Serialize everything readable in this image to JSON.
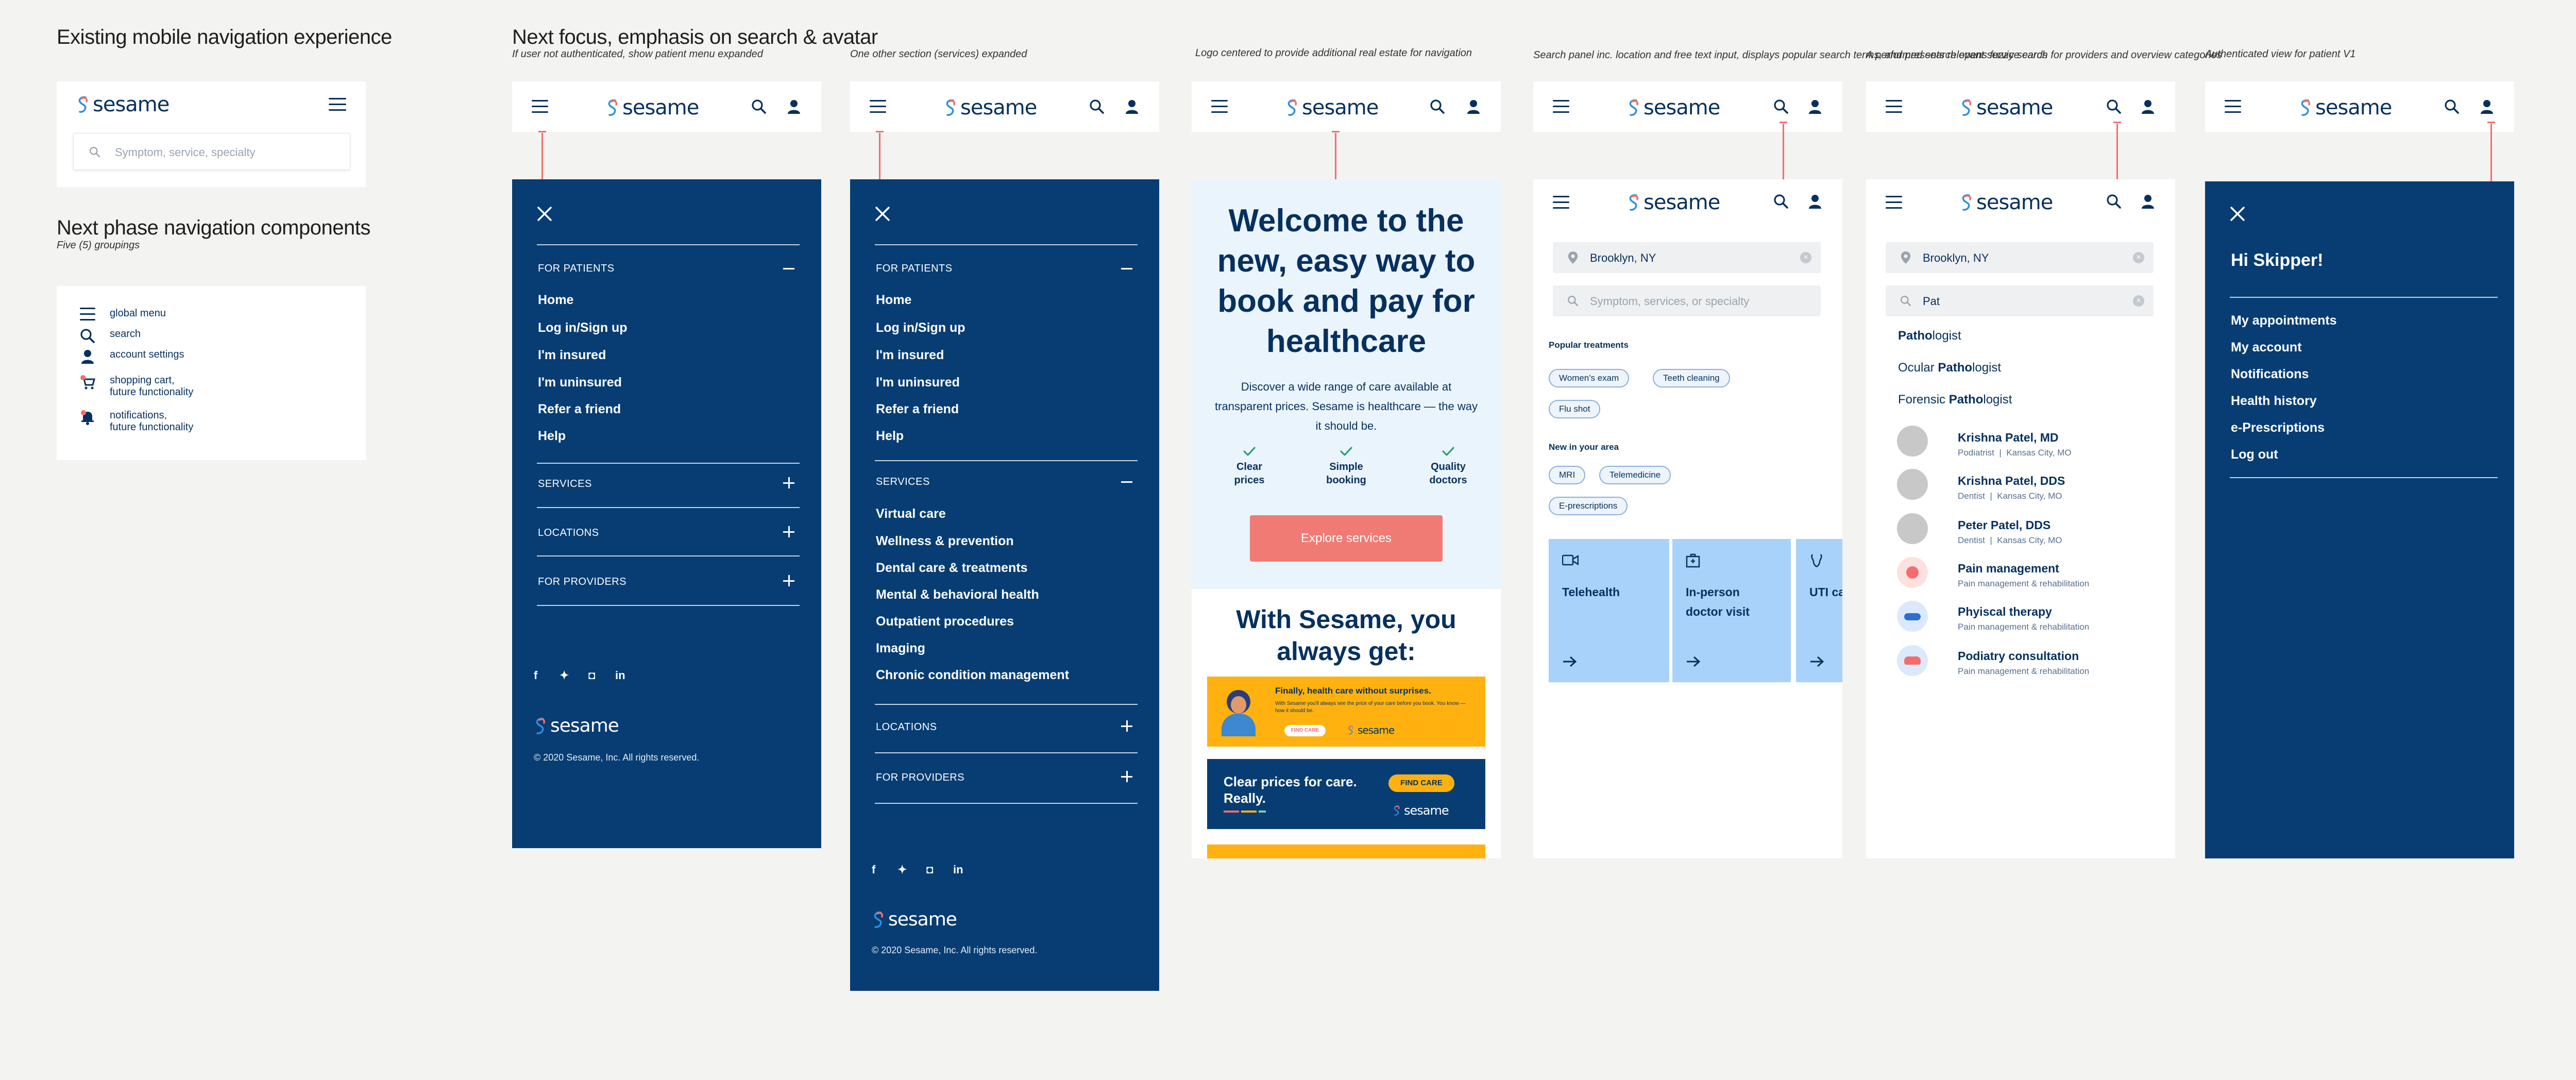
{
  "headings": {
    "existing": "Existing mobile navigation experience",
    "next_focus": "Next focus, emphasis on search & avatar",
    "next_focus_sub": "If user not authenticated, show patient menu expanded",
    "next_phase": "Next phase navigation components",
    "next_phase_sub": "Five (5) groupings"
  },
  "captions": {
    "c3": "One other section (services) expanded",
    "c4": "Logo centered to provide additional real estate for navigation",
    "c5": "Search panel inc. location and free text input, displays popular search terms, and presents relevant service cards",
    "c6": "A performed search opens fuzzy search for providers and overview categories",
    "c7": "Authenticated view for patient V1"
  },
  "brand": {
    "logo_text": "sesame",
    "navy": "#073d73",
    "accent": "#f46d6d"
  },
  "existing": {
    "search_placeholder": "Symptom, service, specialty"
  },
  "legend": [
    {
      "icon": "hamburger-icon",
      "label": "global menu"
    },
    {
      "icon": "search-icon",
      "label": "search"
    },
    {
      "icon": "user-icon",
      "label": "account settings"
    },
    {
      "icon": "cart-icon",
      "label": "shopping cart,",
      "label2": "future functionality"
    },
    {
      "icon": "bell-icon",
      "label": "notifications,",
      "label2": "future functionality"
    }
  ],
  "menu": {
    "for_patients": "FOR PATIENTS",
    "patients_items": [
      "Home",
      "Log in/Sign up",
      "I'm insured",
      "I'm uninsured",
      "Refer a friend",
      "Help"
    ],
    "services": "SERVICES",
    "services_items": [
      "Virtual care",
      "Wellness & prevention",
      "Dental care & treatments",
      "Mental & behavioral health",
      "Outpatient procedures",
      "Imaging",
      "Chronic condition management"
    ],
    "locations": "LOCATIONS",
    "for_providers": "FOR PROVIDERS",
    "copyright": "© 2020 Sesame, Inc. All rights reserved."
  },
  "hero": {
    "title": "Welcome to the new, easy way to book and pay for healthcare",
    "body": "Discover a wide range of care available at transparent prices. Sesame is healthcare — the way it should be.",
    "benefits": [
      {
        "l1": "Clear",
        "l2": "prices"
      },
      {
        "l1": "Simple",
        "l2": "booking"
      },
      {
        "l1": "Quality",
        "l2": "doctors"
      }
    ],
    "cta": "Explore services",
    "with_title": "With Sesame, you always get:",
    "banner1_title": "Finally, health care without surprises.",
    "banner1_body": "With Sesame you'll always see the price of your care before you book. You know — how it should be.",
    "banner1_cta": "FIND CARE",
    "banner2_title": "Clear prices for care. Really.",
    "banner2_cta": "FIND CARE"
  },
  "search_panel": {
    "location": "Brooklyn, NY",
    "placeholder": "Symptom, services, or specialty",
    "popular_label": "Popular treatments",
    "popular": [
      "Women's exam",
      "Teeth cleaning",
      "Flu shot"
    ],
    "new_label": "New in your area",
    "new_items": [
      "MRI",
      "Telemedicine",
      "E-prescriptions"
    ],
    "cards": [
      "Telehealth",
      "In-person doctor visit",
      "UTI care"
    ]
  },
  "search_results": {
    "location": "Brooklyn, NY",
    "query": "Pat",
    "suggestions": [
      {
        "pre": "",
        "bold": "Patho",
        "post": "logist"
      },
      {
        "pre": "Ocular ",
        "bold": "Patho",
        "post": "logist"
      },
      {
        "pre": "Forensic ",
        "bold": "Patho",
        "post": "logist"
      }
    ],
    "providers": [
      {
        "name": "Krishna Patel, MD",
        "role": "Podiatrist",
        "loc": "Kansas City, MO"
      },
      {
        "name": "Krishna Patel, DDS",
        "role": "Dentist",
        "loc": "Kansas City, MO"
      },
      {
        "name": "Peter Patel, DDS",
        "role": "Dentist",
        "loc": "Kansas City, MO"
      }
    ],
    "categories": [
      {
        "name": "Pain management",
        "sub": "Pain management & rehabilitation"
      },
      {
        "name": "Phyiscal therapy",
        "sub": "Pain management & rehabilitation"
      },
      {
        "name": "Podiatry consultation",
        "sub": "Pain management & rehabilitation"
      }
    ]
  },
  "auth": {
    "greeting": "Hi Skipper!",
    "items": [
      "My appointments",
      "My account",
      "Notifications",
      "Health history",
      "e-Prescriptions",
      "Log out"
    ]
  }
}
